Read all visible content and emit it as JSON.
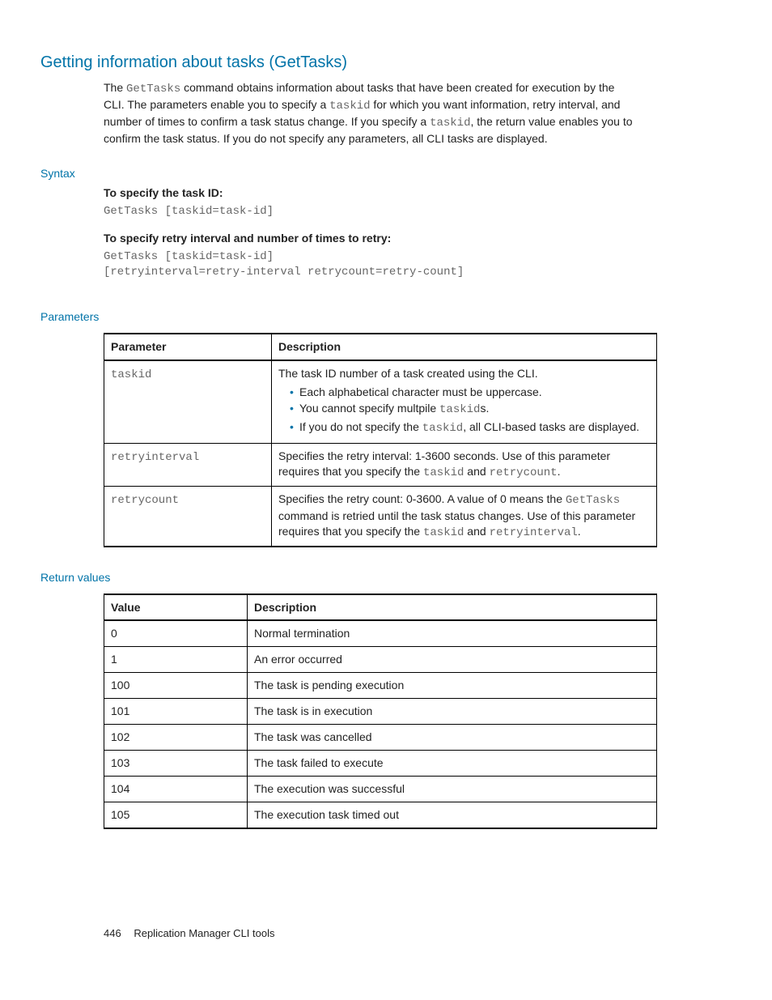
{
  "title": "Getting information about tasks (GetTasks)",
  "intro": {
    "pre1": "The ",
    "cmd1": "GetTasks",
    "mid1": " command obtains information about tasks that have been created for execution by the CLI. The parameters enable you to specify a ",
    "code_taskid1": "taskid",
    "mid2": " for which you want information, retry interval, and number of times to confirm a task status change. If you specify a ",
    "code_taskid2": "taskid",
    "mid3": ", the return value enables you to confirm the task status. If you do not specify any parameters, all CLI tasks are displayed."
  },
  "syntax": {
    "label": "Syntax",
    "spec1_label": "To specify the task ID:",
    "spec1_code": "GetTasks [taskid=task-id]",
    "spec2_label": "To specify retry interval and number of times to retry:",
    "spec2_code_line1": "GetTasks [taskid=task-id]",
    "spec2_code_line2": "[retryinterval=retry-interval retrycount=retry-count]"
  },
  "parameters": {
    "label": "Parameters",
    "headers": {
      "c1": "Parameter",
      "c2": "Description"
    },
    "rows": [
      {
        "param": "taskid",
        "desc_lead": "The task ID number of a task created using the CLI.",
        "bullets": [
          {
            "text": "Each alphabetical character must be uppercase."
          },
          {
            "pre": "You cannot specify multpile ",
            "code": "taskid",
            "post": "s."
          },
          {
            "pre": "If you do not specify the ",
            "code": "taskid",
            "post": ", all CLI-based tasks are displayed."
          }
        ]
      },
      {
        "param": "retryinterval",
        "desc_pre": "Specifies the retry interval: 1-3600 seconds. Use of this parameter requires that you specify the ",
        "code1": "taskid",
        "mid": " and ",
        "code2": "retrycount",
        "post": "."
      },
      {
        "param": "retrycount",
        "desc_pre": "Specifies the retry count: 0-3600. A value of 0 means the ",
        "code_cmd": "GetTasks",
        "mid1": " command is retried until the task status changes. Use of this parameter requires that you specify the ",
        "code1": "taskid",
        "mid2": " and ",
        "code2": "retryinterval",
        "post": "."
      }
    ]
  },
  "return_values": {
    "label": "Return values",
    "headers": {
      "c1": "Value",
      "c2": "Description"
    },
    "rows": [
      {
        "v": "0",
        "d": "Normal termination"
      },
      {
        "v": "1",
        "d": "An error occurred"
      },
      {
        "v": "100",
        "d": "The task is pending execution"
      },
      {
        "v": "101",
        "d": "The task is in execution"
      },
      {
        "v": "102",
        "d": "The task was cancelled"
      },
      {
        "v": "103",
        "d": "The task failed to execute"
      },
      {
        "v": "104",
        "d": "The execution was successful"
      },
      {
        "v": "105",
        "d": "The execution task timed out"
      }
    ]
  },
  "footer": {
    "page_no": "446",
    "doc_title": "Replication Manager CLI tools"
  }
}
